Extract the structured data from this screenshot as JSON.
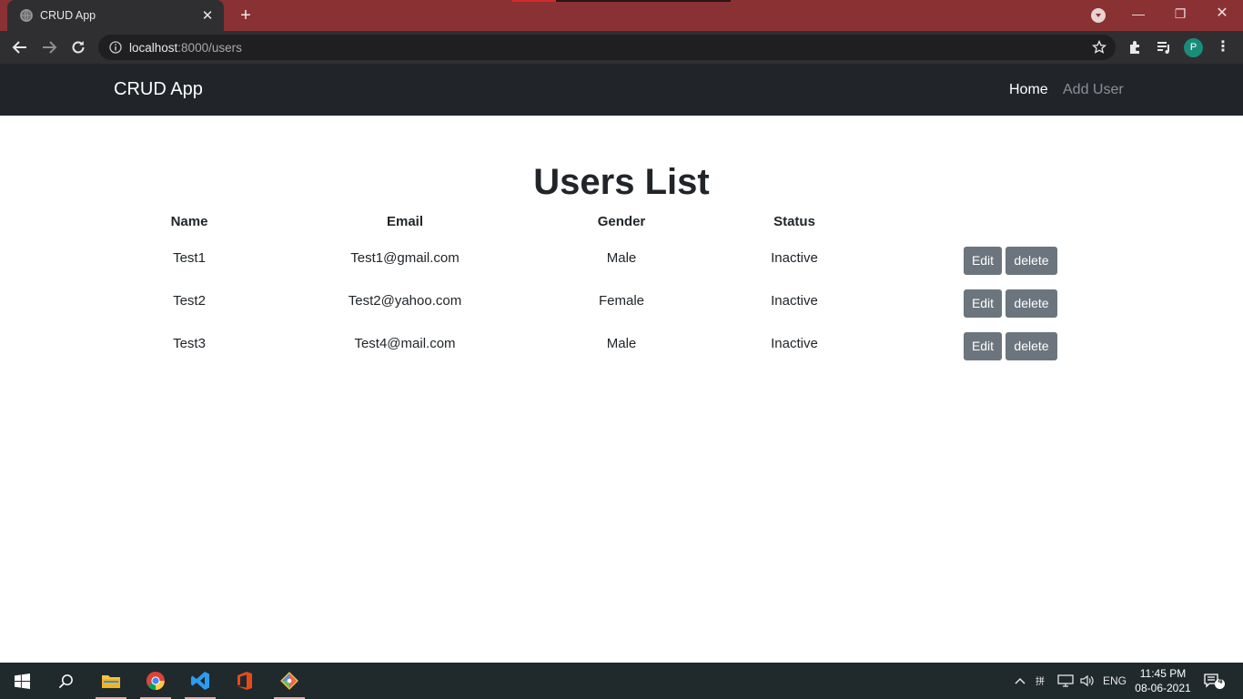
{
  "browser": {
    "tab_title": "CRUD App",
    "url_host": "localhost",
    "url_path": ":8000/users",
    "profile_initial": "P"
  },
  "navbar": {
    "brand": "CRUD App",
    "links": [
      "Home",
      "Add User"
    ]
  },
  "page": {
    "title": "Users List",
    "columns": [
      "Name",
      "Email",
      "Gender",
      "Status"
    ],
    "rows": [
      {
        "name": "Test1",
        "email": "Test1@gmail.com",
        "gender": "Male",
        "status": "Inactive"
      },
      {
        "name": "Test2",
        "email": "Test2@yahoo.com",
        "gender": "Female",
        "status": "Inactive"
      },
      {
        "name": "Test3",
        "email": "Test4@mail.com",
        "gender": "Male",
        "status": "Inactive"
      }
    ],
    "edit_label": "Edit",
    "delete_label": "delete"
  },
  "taskbar": {
    "language": "ENG",
    "time": "11:45 PM",
    "date": "08-06-2021",
    "notification_count": "4"
  },
  "colors": {
    "tabstrip": "#8a3134",
    "navbar": "#212529",
    "button": "#6c757d",
    "taskbar": "#202a2c"
  }
}
